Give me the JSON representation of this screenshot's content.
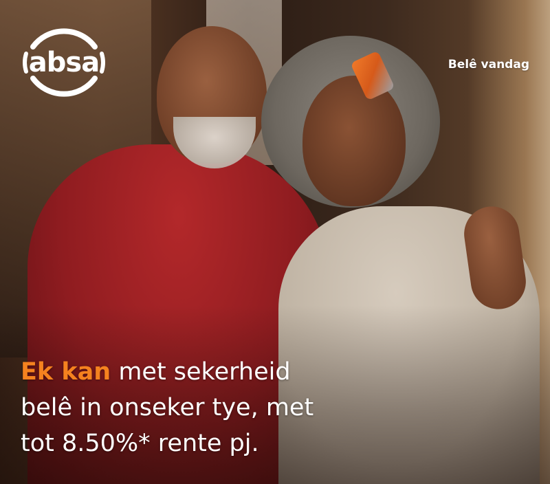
{
  "brand": {
    "logo_text": "absa",
    "accent_color": "#f5821f"
  },
  "cta": {
    "label": "Belê vandag"
  },
  "headline": {
    "accent": "Ek kan",
    "line1_rest": " met sekerheid",
    "line2": "belê in onseker tye, met",
    "line3": "tot 8.50%* rente pj."
  },
  "image": {
    "icon_names": [
      "absa-logo-icon"
    ]
  }
}
